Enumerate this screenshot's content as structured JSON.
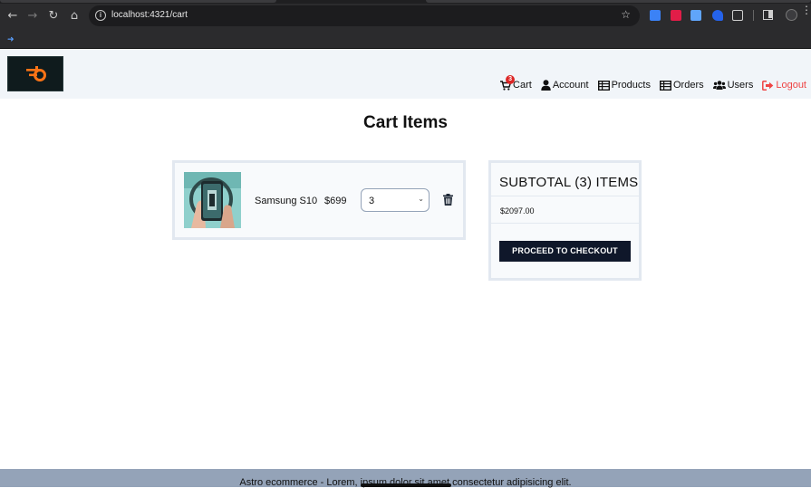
{
  "browser": {
    "url": "localhost:4321/cart",
    "back_icon": "back-arrow-icon",
    "forward_icon": "forward-arrow-icon",
    "reload_icon": "reload-icon",
    "home_icon": "home-icon"
  },
  "header": {
    "logo_icon": "astro-logo-icon",
    "nav": {
      "cart_label": "Cart",
      "cart_count": "3",
      "account_label": "Account",
      "products_label": "Products",
      "orders_label": "Orders",
      "users_label": "Users",
      "logout_label": "Logout"
    },
    "colors": {
      "background": "#f1f5f9",
      "logout": "#ef4444"
    }
  },
  "main": {
    "title": "Cart Items",
    "cart_items": [
      {
        "name": "Samsung S10",
        "price": "$699",
        "quantity": "3"
      }
    ],
    "summary": {
      "title": "SUBTOTAL (3) ITEMS",
      "total": "$2097.00",
      "checkout_label": "PROCEED TO CHECKOUT"
    }
  },
  "footer": {
    "text": "Astro ecommerce - Lorem, ipsum dolor sit amet consectetur adipisicing elit."
  }
}
